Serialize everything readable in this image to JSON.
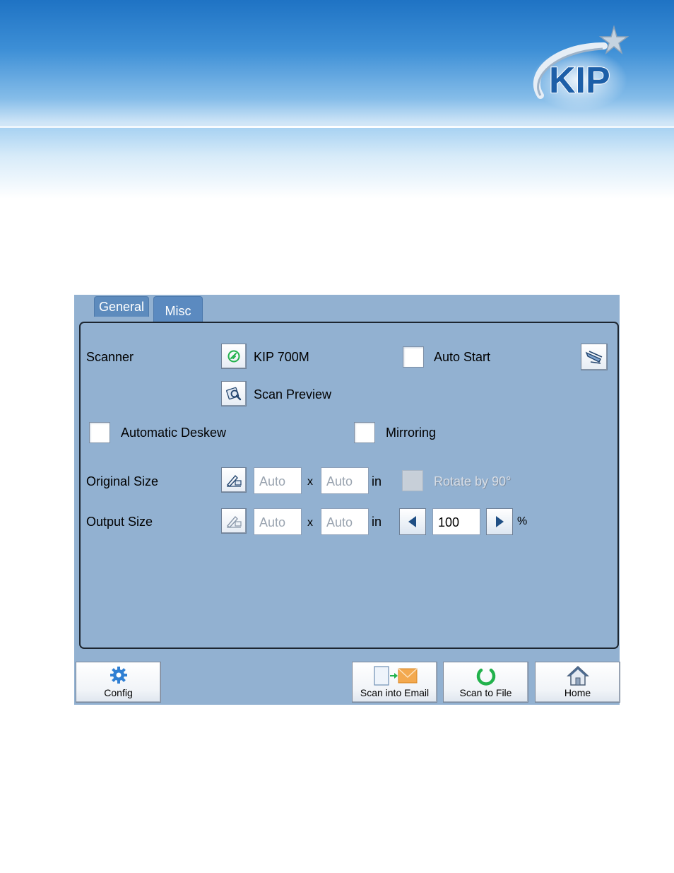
{
  "brand": {
    "logo_text": "KIP"
  },
  "tabs": [
    {
      "label": "General"
    },
    {
      "label": "Misc"
    }
  ],
  "scanner": {
    "label": "Scanner",
    "device_name": "KIP 700M",
    "auto_start_label": "Auto Start",
    "auto_start_checked": false,
    "scan_preview_label": "Scan Preview"
  },
  "options": {
    "automatic_deskew_label": "Automatic Deskew",
    "automatic_deskew_checked": false,
    "mirroring_label": "Mirroring",
    "mirroring_checked": false
  },
  "original_size": {
    "label": "Original Size",
    "width_value": "Auto",
    "times": "x",
    "height_value": "Auto",
    "unit": "in",
    "rotate_label": "Rotate by 90°",
    "rotate_enabled": false
  },
  "output_size": {
    "label": "Output Size",
    "width_value": "Auto",
    "times": "x",
    "height_value": "Auto",
    "unit": "in",
    "scale_value": "100",
    "scale_unit": "%"
  },
  "toolbar": {
    "config_label": "Config",
    "scan_email_label": "Scan into Email",
    "scan_file_label": "Scan to File",
    "home_label": "Home"
  },
  "colors": {
    "panel_bg": "#92b1d1",
    "tab_bg": "#5b8ac0",
    "accent_green": "#22b24c",
    "header_blue": "#1f73c4"
  }
}
